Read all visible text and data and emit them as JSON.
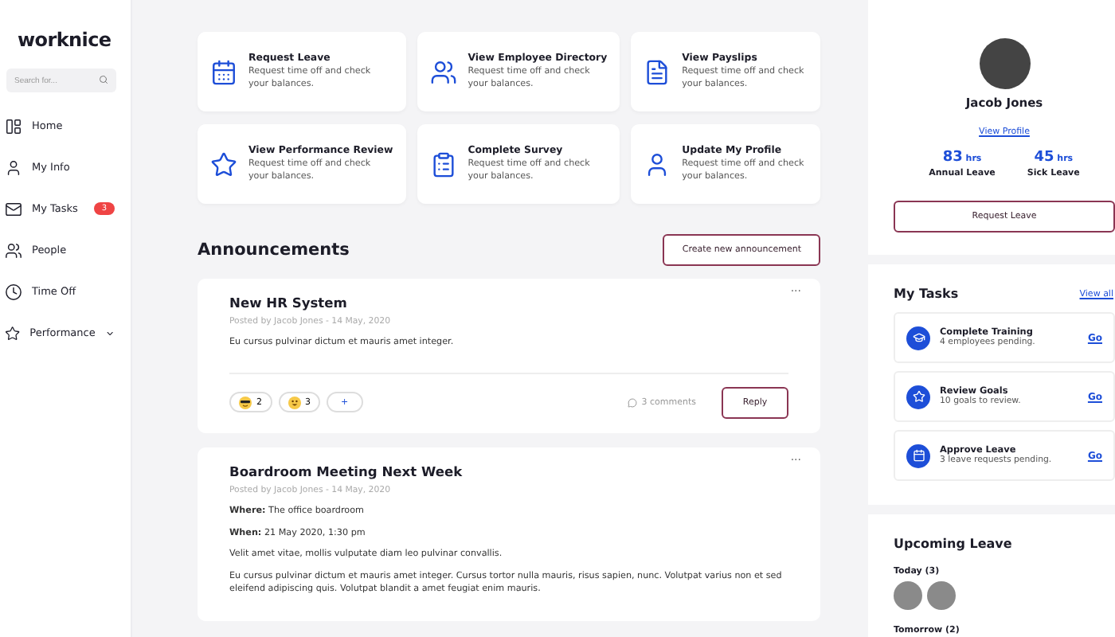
{
  "sidebar": {
    "logo": "worknice",
    "search": {
      "placeholder": "Search for..."
    },
    "items": [
      {
        "label": "Home"
      },
      {
        "label": "My Info"
      },
      {
        "label": "My Tasks",
        "badge": "3"
      },
      {
        "label": "People"
      },
      {
        "label": "Time Off"
      },
      {
        "label": "Performance",
        "expandable": true
      }
    ]
  },
  "quick_actions": [
    {
      "title": "Request Leave",
      "description": "Request time off and check your balances."
    },
    {
      "title": "View Employee Directory",
      "description": "Request time off and check your balances."
    },
    {
      "title": "View Payslips",
      "description": "Request time off and check your balances."
    },
    {
      "title": "View Performance Review",
      "description": "Request time off and check your balances."
    },
    {
      "title": "Complete Survey",
      "description": "Request time off and check your balances."
    },
    {
      "title": "Update My Profile",
      "description": "Request time off and check your balances."
    }
  ],
  "announcements": {
    "title": "Announcements",
    "create_button": "Create new announcement",
    "menu": "···",
    "posts": [
      {
        "title": "New HR System",
        "meta": "Posted by Jacob Jones - 14 May, 2020",
        "paragraphs": [
          "Eu cursus pulvinar dictum et mauris amet integer."
        ],
        "reactions": [
          {
            "count": "2"
          },
          {
            "count": "3"
          }
        ],
        "add_reaction": "+",
        "comments": "3 comments",
        "reply": "Reply"
      },
      {
        "title": "Boardroom Meeting Next Week",
        "meta": "Posted by Jacob Jones - 14 May, 2020",
        "paragraphs": [
          "**Where:** The office boardroom",
          "**When:** 21 May 2020, 1:30 pm",
          "Velit amet vitae, mollis vulputate diam leo pulvinar convallis.",
          "Eu cursus pulvinar dictum et mauris amet integer. Cursus tortor nulla mauris, risus sapien, nunc. Volutpat varius non et sed eleifend adipiscing quis. Volutpat blandit a amet feugiat enim mauris."
        ]
      }
    ]
  },
  "profile": {
    "name": "Jacob Jones",
    "link": "View Profile",
    "balances": [
      {
        "value": "83",
        "unit": "hrs",
        "label": "Annual Leave"
      },
      {
        "value": "45",
        "unit": "hrs",
        "label": "Sick Leave"
      }
    ],
    "button": "Request Leave"
  },
  "tasks": {
    "title": "My Tasks",
    "link": "View all",
    "items": [
      {
        "title": "Complete Training",
        "subtitle": "4 employees pending.",
        "action": "Go"
      },
      {
        "title": "Review Goals",
        "subtitle": "10 goals to review.",
        "action": "Go"
      },
      {
        "title": "Approve Leave",
        "subtitle": "3 leave requests pending.",
        "action": "Go"
      }
    ]
  },
  "upcoming_leave": {
    "title": "Upcoming Leave",
    "groups": [
      {
        "label": "Today (3)"
      },
      {
        "label": "Tomorrow (2)"
      }
    ]
  }
}
